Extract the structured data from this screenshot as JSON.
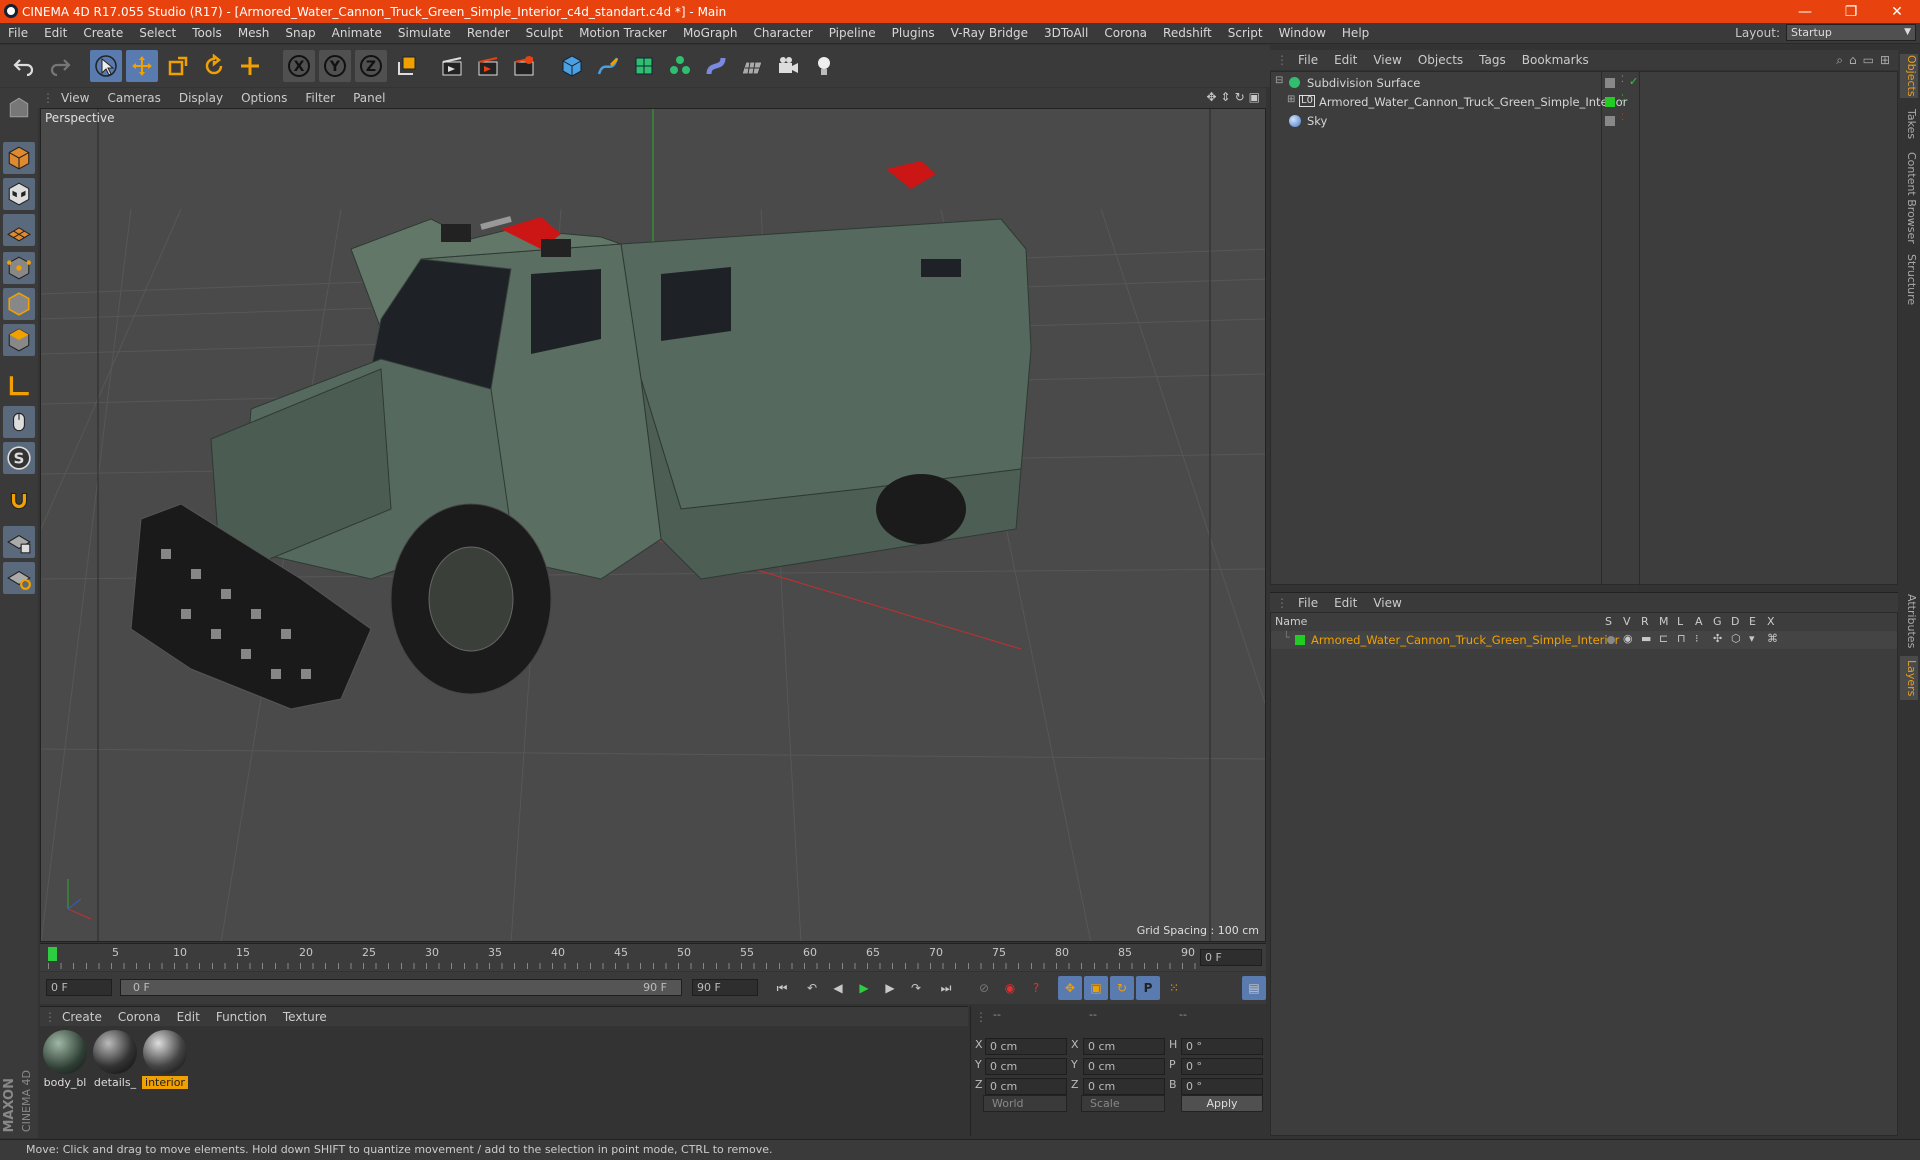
{
  "window": {
    "title": "CINEMA 4D R17.055 Studio (R17) - [Armored_Water_Cannon_Truck_Green_Simple_Interior_c4d_standart.c4d *] - Main",
    "minimize": "—",
    "restore": "❐",
    "close": "✕"
  },
  "menu": [
    "File",
    "Edit",
    "Create",
    "Select",
    "Tools",
    "Mesh",
    "Snap",
    "Animate",
    "Simulate",
    "Render",
    "Sculpt",
    "Motion Tracker",
    "MoGraph",
    "Character",
    "Pipeline",
    "Plugins",
    "V-Ray Bridge",
    "3DToAll",
    "Corona",
    "Redshift",
    "Script",
    "Window",
    "Help"
  ],
  "layout": {
    "label": "Layout:",
    "value": "Startup"
  },
  "viewport": {
    "menu": [
      "View",
      "Cameras",
      "Display",
      "Options",
      "Filter",
      "Panel"
    ],
    "label": "Perspective",
    "grid_spacing": "Grid Spacing : 100 cm"
  },
  "timeline": {
    "ticks": [
      "0",
      "5",
      "10",
      "15",
      "20",
      "25",
      "30",
      "35",
      "40",
      "45",
      "50",
      "55",
      "60",
      "65",
      "70",
      "75",
      "80",
      "85",
      "90"
    ],
    "current_frame": "0 F",
    "start_field": "0 F",
    "range_start": "0 F",
    "range_end": "90 F",
    "end_field": "90 F"
  },
  "materials": {
    "menu": [
      "Create",
      "Corona",
      "Edit",
      "Function",
      "Texture"
    ],
    "items": [
      {
        "label": "body_bl",
        "active": false
      },
      {
        "label": "details_",
        "active": false
      },
      {
        "label": "interior",
        "active": true
      }
    ]
  },
  "coords": {
    "headers": [
      "--",
      "--",
      "--"
    ],
    "rows": [
      {
        "a": "X",
        "v1": "0 cm",
        "b": "X",
        "v2": "0 cm",
        "c": "H",
        "v3": "0 °"
      },
      {
        "a": "Y",
        "v1": "0 cm",
        "b": "Y",
        "v2": "0 cm",
        "c": "P",
        "v3": "0 °"
      },
      {
        "a": "Z",
        "v1": "0 cm",
        "b": "Z",
        "v2": "0 cm",
        "c": "B",
        "v3": "0 °"
      }
    ],
    "world": "World",
    "scale": "Scale",
    "apply": "Apply"
  },
  "objects": {
    "menu": [
      "File",
      "Edit",
      "View",
      "Objects",
      "Tags",
      "Bookmarks"
    ],
    "rows": [
      {
        "name": "Subdivision Surface",
        "icon": "subdivision-icon"
      },
      {
        "name": "Armored_Water_Cannon_Truck_Green_Simple_Interior",
        "icon": "null-icon"
      },
      {
        "name": "Sky",
        "icon": "sky-icon"
      }
    ]
  },
  "layers": {
    "menu": [
      "File",
      "Edit",
      "View"
    ],
    "name_header": "Name",
    "flags": [
      "S",
      "V",
      "R",
      "M",
      "L",
      "A",
      "G",
      "D",
      "E",
      "X"
    ],
    "rows": [
      {
        "name": "Armored_Water_Cannon_Truck_Green_Simple_Interior"
      }
    ]
  },
  "right_tabs": [
    "Objects",
    "Takes",
    "Content Browser",
    "Structure",
    "Attributes",
    "Layers"
  ],
  "status": "Move: Click and drag to move elements. Hold down SHIFT to quantize movement / add to the selection in point mode, CTRL to remove.",
  "logo": {
    "maxon": "MAXON",
    "cinema": "CINEMA 4D"
  },
  "colors": {
    "accent": "#e8430f",
    "selection": "#5a7bb0",
    "active_material": "#f0a000",
    "layer_green": "#22cc22"
  }
}
